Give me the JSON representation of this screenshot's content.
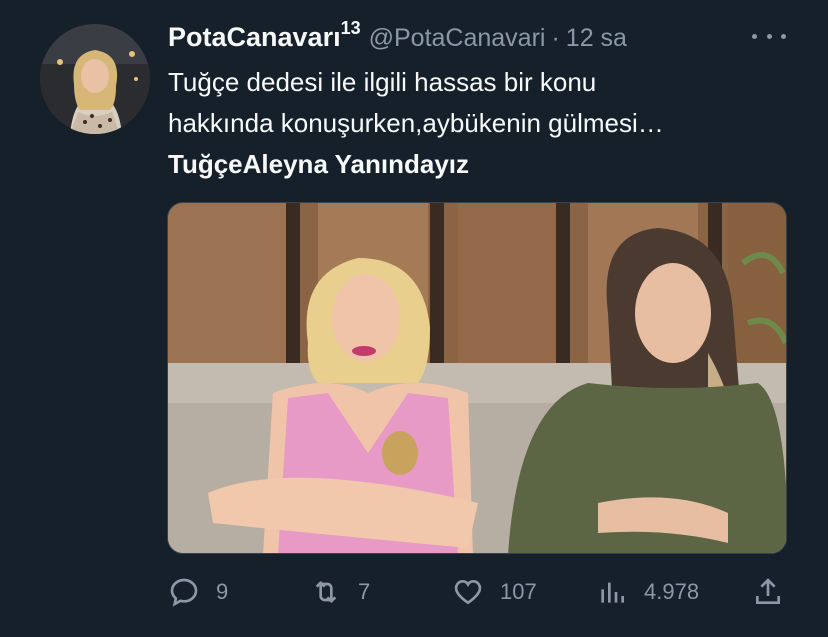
{
  "tweet": {
    "author_name": "PotaCanavarı",
    "author_badge": "13",
    "handle": "@PotaCanavari",
    "separator": "·",
    "time": "12 sa",
    "text_line1": "Tuğçe dedesi ile ilgili hassas bir konu",
    "text_line2": "hakkında konuşurken,aybükenin gülmesi…",
    "text_line3": "TuğçeAleyna Yanındayız"
  },
  "actions": {
    "replies": "9",
    "retweets": "7",
    "likes": "107",
    "views": "4.978"
  },
  "colors": {
    "background": "#15202b",
    "text": "#f7f9f9",
    "muted": "#8b98a5"
  },
  "icons": [
    "more-icon",
    "reply-icon",
    "retweet-icon",
    "like-icon",
    "views-icon",
    "share-icon"
  ]
}
